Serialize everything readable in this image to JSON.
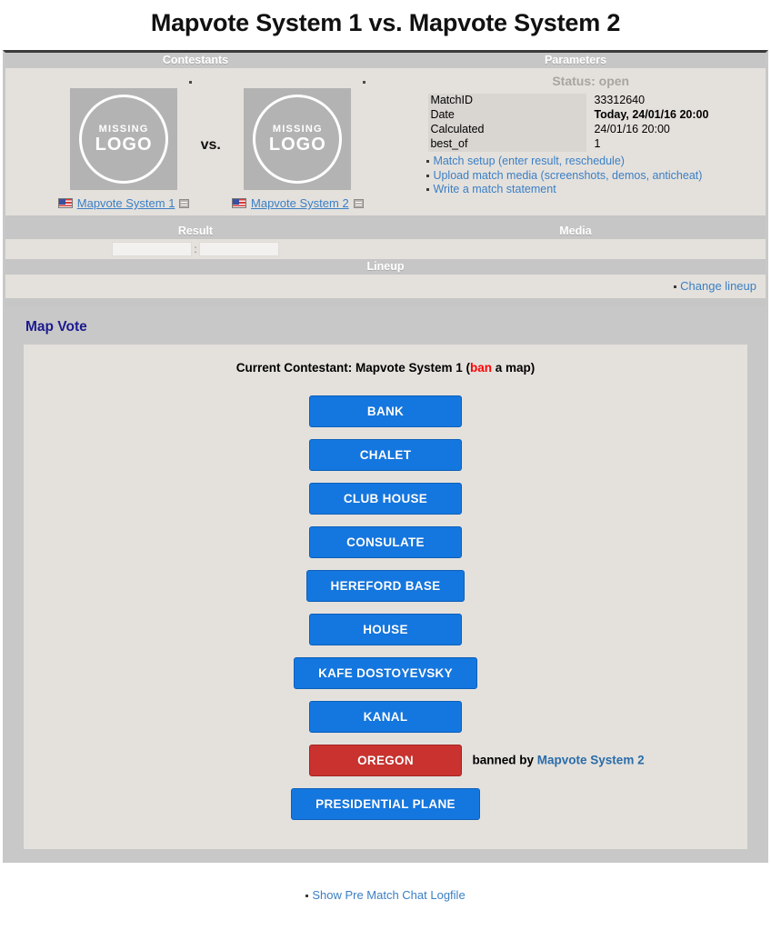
{
  "page": {
    "title": "Mapvote System 1 vs. Mapvote System 2"
  },
  "headers": {
    "contestants": "Contestants",
    "parameters": "Parameters",
    "result": "Result",
    "media": "Media",
    "lineup": "Lineup"
  },
  "contestants": {
    "left": {
      "name": "Mapvote System 1",
      "logo_line1": "MISSING",
      "logo_line2": "LOGO",
      "flag_icon": "us-flag-icon",
      "profile_icon": "profile-icon"
    },
    "vs_label": "vs.",
    "right": {
      "name": "Mapvote System 2",
      "logo_line1": "MISSING",
      "logo_line2": "LOGO",
      "flag_icon": "us-flag-icon",
      "profile_icon": "profile-icon"
    }
  },
  "parameters": {
    "status": "Status: open",
    "rows": [
      {
        "key": "MatchID",
        "value": "33312640",
        "bold": false
      },
      {
        "key": "Date",
        "value": "Today, 24/01/16 20:00",
        "bold": true
      },
      {
        "key": "Calculated",
        "value": "24/01/16 20:00",
        "bold": false
      },
      {
        "key": "best_of",
        "value": "1",
        "bold": false
      }
    ],
    "links": [
      "Match setup (enter result, reschedule)",
      "Upload match media (screenshots, demos, anticheat)",
      "Write a match statement"
    ]
  },
  "result": {
    "score_home": "",
    "score_away": "",
    "separator": ":"
  },
  "lineup": {
    "change_link": "Change lineup"
  },
  "mapvote": {
    "section_title": "Map Vote",
    "current_prefix": "Current Contestant: Mapvote System 1 (",
    "current_ban_word": "ban",
    "current_suffix": " a map)",
    "maps": [
      {
        "name": "BANK",
        "state": "available",
        "banned_by": ""
      },
      {
        "name": "CHALET",
        "state": "available",
        "banned_by": ""
      },
      {
        "name": "CLUB HOUSE",
        "state": "available",
        "banned_by": ""
      },
      {
        "name": "CONSULATE",
        "state": "available",
        "banned_by": ""
      },
      {
        "name": "HEREFORD BASE",
        "state": "available",
        "banned_by": ""
      },
      {
        "name": "HOUSE",
        "state": "available",
        "banned_by": ""
      },
      {
        "name": "KAFE DOSTOYEVSKY",
        "state": "available",
        "banned_by": ""
      },
      {
        "name": "KANAL",
        "state": "available",
        "banned_by": ""
      },
      {
        "name": "OREGON",
        "state": "banned",
        "banned_by": "Mapvote System 2",
        "banned_label": "banned by "
      },
      {
        "name": "PRESIDENTIAL PLANE",
        "state": "available",
        "banned_by": ""
      }
    ]
  },
  "footer": {
    "chat_log_link": "Show Pre Match Chat Logfile"
  },
  "colors": {
    "map_button": "#1477e0",
    "map_button_banned": "#c9322f",
    "link": "#3b7fc4",
    "section_title": "#1b1b8f",
    "ban_word": "#ff0000"
  }
}
